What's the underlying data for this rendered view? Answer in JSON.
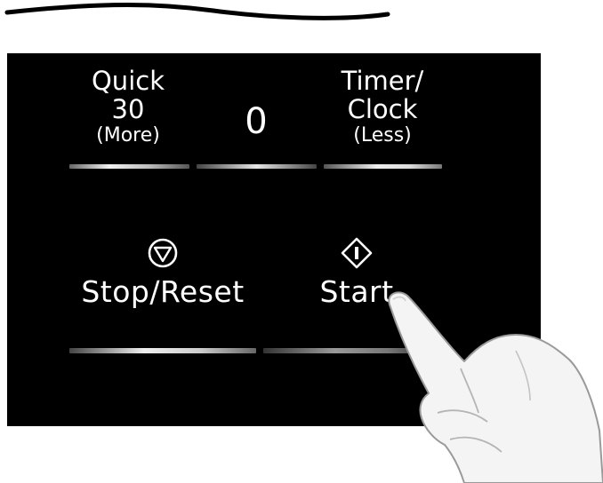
{
  "panel": {
    "quick30": {
      "line1": "Quick",
      "line2": "30",
      "line3": "(More)"
    },
    "number_display": "0",
    "timer_clock": {
      "line1": "Timer/",
      "line2": "Clock",
      "line3": "(Less)"
    },
    "stop_reset": {
      "label": "Stop/Reset",
      "icon": "stop-circle-triangle-icon"
    },
    "start": {
      "label": "Start",
      "icon": "start-diamond-icon"
    }
  },
  "colors": {
    "panel_background": "#000000",
    "text": "#ffffff",
    "page_background": "#ffffff"
  }
}
